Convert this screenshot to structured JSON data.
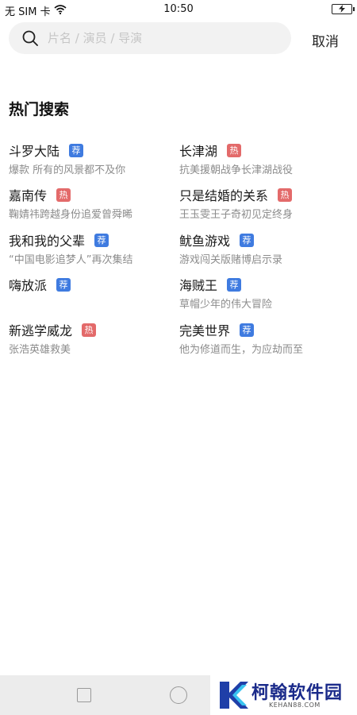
{
  "status_bar": {
    "carrier": "无 SIM 卡",
    "time": "10:50"
  },
  "search": {
    "placeholder": "片名 / 演员 / 导演",
    "cancel_label": "取消"
  },
  "hot_section": {
    "title": "热门搜索",
    "items": [
      {
        "name": "斗罗大陆",
        "badge": "荐",
        "badge_type": "rec",
        "desc": "爆款 所有的风景都不及你"
      },
      {
        "name": "长津湖",
        "badge": "热",
        "badge_type": "hot",
        "desc": "抗美援朝战争长津湖战役"
      },
      {
        "name": "嘉南传",
        "badge": "热",
        "badge_type": "hot",
        "desc": "鞠婧祎跨越身份追爱曾舜晞"
      },
      {
        "name": "只是结婚的关系",
        "badge": "热",
        "badge_type": "hot",
        "desc": "王玉雯王子奇初见定终身"
      },
      {
        "name": "我和我的父辈",
        "badge": "荐",
        "badge_type": "rec",
        "desc": "“中国电影追梦人”再次集结"
      },
      {
        "name": "鱿鱼游戏",
        "badge": "荐",
        "badge_type": "rec",
        "desc": "游戏闯关版赌博启示录"
      },
      {
        "name": "嗨放派",
        "badge": "荐",
        "badge_type": "rec",
        "desc": ""
      },
      {
        "name": "海贼王",
        "badge": "荐",
        "badge_type": "rec",
        "desc": "草帽少年的伟大冒险"
      },
      {
        "name": "新逃学威龙",
        "badge": "热",
        "badge_type": "hot",
        "desc": "张浩英雄救美"
      },
      {
        "name": "完美世界",
        "badge": "荐",
        "badge_type": "rec",
        "desc": "他为修道而生，为应劫而至"
      }
    ]
  },
  "colors": {
    "badge_rec": "#3f7be0",
    "badge_hot": "#e36a6a"
  },
  "watermark": {
    "name": "柯翰软件园",
    "url": "KEHAN88.COM"
  }
}
